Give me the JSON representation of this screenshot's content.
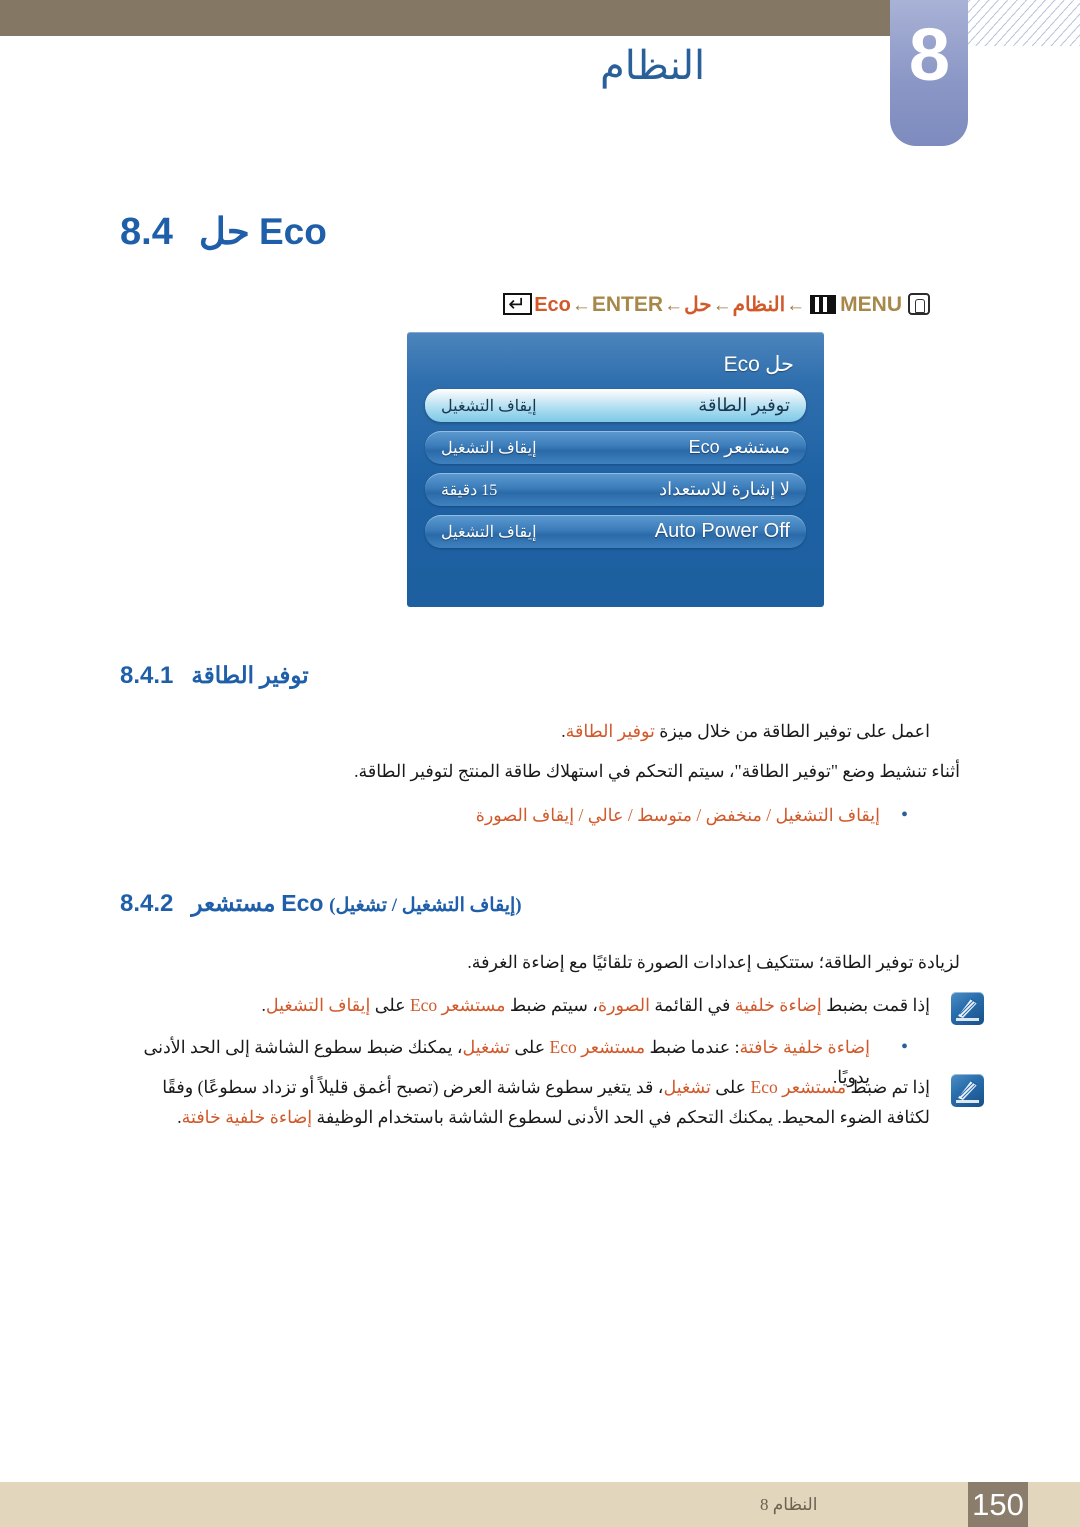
{
  "header": {
    "chapter_number": "8",
    "chapter_title": "النظام"
  },
  "page_title": {
    "number": "8.4",
    "title_ar": "حل",
    "title_lat": "Eco"
  },
  "breadcrumb": {
    "hand_icon": "hand-press-icon",
    "menu_icon": "menu-bars-icon",
    "menu_label": "MENU",
    "arrow1": "←",
    "item_system": "النظام",
    "arrow2": "←",
    "item_hal": "حل",
    "arrow3": "←",
    "item_eco": "Eco",
    "arrow4": "←",
    "enter_label": "ENTER",
    "enter_icon": "enter-key-icon"
  },
  "osd": {
    "title_ar": "حل",
    "title_lat": "Eco",
    "rows": [
      {
        "label": "توفير الطاقة",
        "label_latin": "",
        "value": "إيقاف التشغيل",
        "selected": true
      },
      {
        "label": "مستشعر",
        "label_latin": "Eco",
        "value": "إيقاف التشغيل",
        "selected": false
      },
      {
        "label": "لا إشارة للاستعداد",
        "label_latin": "",
        "value": "15 دقيقة",
        "selected": false
      },
      {
        "label": "",
        "label_latin": "Auto Power Off",
        "value": "إيقاف التشغيل",
        "selected": false
      }
    ]
  },
  "section_841": {
    "number": "8.4.1",
    "title": "توفير الطاقة",
    "para1_a": "اعمل على توفير الطاقة من خلال ميزة ",
    "para1_hl": "توفير الطاقة",
    "para1_b": ".",
    "para2": "أثناء تنشيط وضع \"توفير الطاقة\"، سيتم التحكم في استهلاك طاقة المنتج لتوفير الطاقة.",
    "bullet1": "إيقاف التشغيل / منخفض / متوسط / عالي / إيقاف الصورة"
  },
  "section_842": {
    "number": "8.4.2",
    "title_ar": "مستشعر",
    "title_lat": "Eco",
    "title_paren": "(إيقاف التشغيل / تشغيل)",
    "para1": "لزيادة توفير الطاقة؛ ستتكيف إعدادات الصورة تلقائيًا مع إضاءة الغرفة.",
    "note1_a": "إذا قمت بضبط ",
    "note1_hl1": "إضاءة خلفية",
    "note1_b": " في القائمة ",
    "note1_hl2": "الصورة",
    "note1_c": "، سيتم ضبط ",
    "note1_hl3": "مستشعر Eco",
    "note1_d": " على ",
    "note1_hl4": "إيقاف التشغيل",
    "note1_e": ".",
    "bullet_hl": "إضاءة خلفية خافتة",
    "bullet_a": ": عندما ضبط ",
    "bullet_hl2": "مستشعر Eco",
    "bullet_b": " على ",
    "bullet_hl3": "تشغيل",
    "bullet_c": "، يمكنك ضبط سطوع الشاشة إلى الحد الأدنى يدويًا.",
    "note2_a": "إذا تم ضبط ",
    "note2_hl1": "مستشعر Eco",
    "note2_b": " على ",
    "note2_hl2": "تشغيل",
    "note2_c": "، قد يتغير سطوع شاشة العرض (تصبح أغمق قليلاً أو تزداد سطوعًا) وفقًا لكثافة الضوء المحيط. يمكنك التحكم في الحد الأدنى لسطوع الشاشة باستخدام الوظيفة ",
    "note2_hl3": "إضاءة خلفية خافتة",
    "note2_d": "."
  },
  "footer": {
    "label": "النظام 8",
    "page_number": "150"
  },
  "colors": {
    "header_band": "#847865",
    "chapter_tab": "#8b97c6",
    "heading_blue": "#1f5fa9",
    "highlight_orange": "#d2592a",
    "breadcrumb_tan": "#a8884a",
    "footer_band": "#e2d6bc",
    "footer_page_box": "#8b7d6b",
    "osd_blue": "#1e62a4",
    "osd_selected": "#a8dcf0"
  }
}
